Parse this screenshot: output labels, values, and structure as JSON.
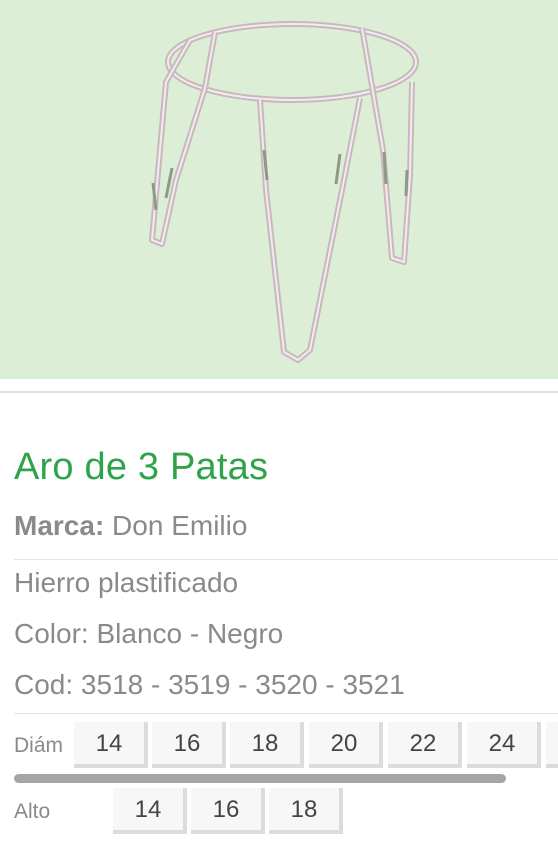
{
  "product": {
    "title": "Aro de 3 Patas",
    "brand_label": "Marca:",
    "brand_value": "Don Emilio",
    "details": [
      "Hierro plastificado",
      "Color: Blanco - Negro",
      "Cod: 3518 - 3519 - 3520 - 3521"
    ],
    "image_alt": "plant-stand-ring-with-three-legs"
  },
  "sizes": {
    "diameter": {
      "label": "Diám",
      "options": [
        "14",
        "16",
        "18",
        "20",
        "22",
        "24"
      ]
    },
    "height": {
      "label": "Alto",
      "options": [
        "14",
        "16",
        "18"
      ]
    }
  },
  "colors": {
    "hero_background": "#dcefd6",
    "title_green": "#2ea34a",
    "text_gray": "#8a8a8a"
  }
}
